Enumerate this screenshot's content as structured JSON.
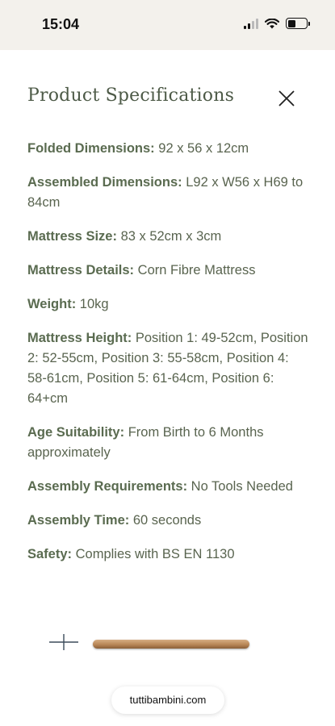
{
  "status_bar": {
    "time": "15:04"
  },
  "panel": {
    "title": "Product Specifications",
    "specs": [
      {
        "label": "Folded Dimensions:",
        "value": "92 x 56 x 12cm"
      },
      {
        "label": "Assembled Dimensions:",
        "value": "L92 x W56 x H69 to 84cm"
      },
      {
        "label": "Mattress Size:",
        "value": "83 x 52cm x 3cm"
      },
      {
        "label": "Mattress Details:",
        "value": "Corn Fibre Mattress"
      },
      {
        "label": "Weight:",
        "value": "10kg"
      },
      {
        "label": "Mattress Height:",
        "value": "Position 1: 49-52cm, Position 2: 52-55cm, Position 3: 55-58cm, Position 4: 58-61cm, Position 5: 61-64cm, Position 6: 64+cm"
      },
      {
        "label": "Age Suitability:",
        "value": "From Birth to 6 Months approximately"
      },
      {
        "label": "Assembly Requirements:",
        "value": "No Tools Needed"
      },
      {
        "label": "Assembly Time:",
        "value": "60 seconds"
      },
      {
        "label": "Safety:",
        "value": "Complies with BS EN 1130"
      }
    ]
  },
  "browser": {
    "url": "tuttibambini.com"
  },
  "colors": {
    "text_green": "#59644f",
    "status_bg": "#f3f1ec"
  },
  "icons": {
    "close": "close-icon",
    "plus": "plus-icon",
    "wifi": "wifi-icon",
    "battery": "battery-icon",
    "signal": "cellular-signal-icon"
  }
}
